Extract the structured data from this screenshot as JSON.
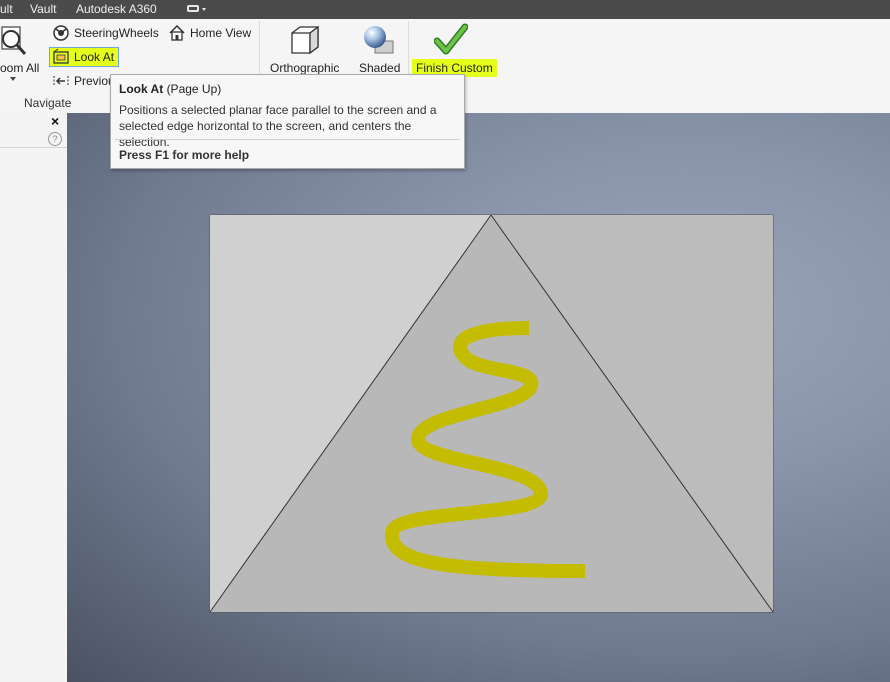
{
  "menubar": {
    "items": [
      "ult",
      "Vault",
      "Autodesk A360"
    ]
  },
  "ribbon": {
    "zoom_all_label": "oom All",
    "steering_wheels_label": "SteeringWheels",
    "home_view_label": "Home View",
    "look_at_label": "Look At",
    "previous_label": "Previou",
    "navigate_panel_label": "Navigate",
    "orthographic_label": "Orthographic",
    "shaded_label": "Shaded",
    "finish_custom_label": "Finish Custom",
    "highlight_color": "#e5ff1a"
  },
  "tooltip": {
    "title": "Look At",
    "shortcut": "(Page Up)",
    "description": "Positions a selected planar face parallel to the screen and a selected edge horizontal to the screen, and centers the selection.",
    "help": "Press F1 for more help"
  },
  "leftpanel": {
    "close_glyph": "×",
    "help_glyph": "?"
  },
  "colors": {
    "menubar_bg": "#4b4b4b",
    "sketch_stroke": "#c4bc00",
    "checkmark": "#4caf3a"
  }
}
